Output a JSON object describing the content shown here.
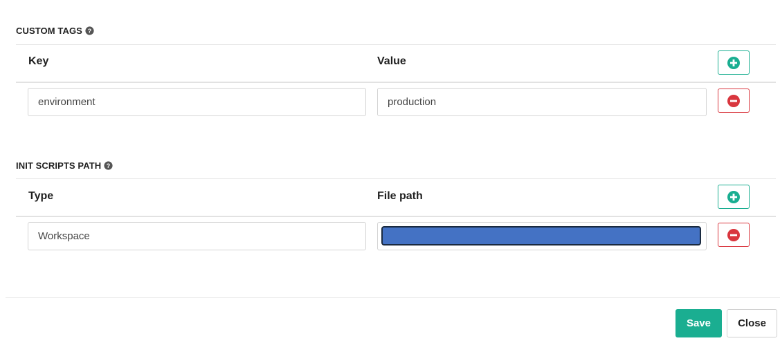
{
  "custom_tags": {
    "title": "CUSTOM TAGS",
    "help_icon": "question-circle-icon",
    "col_key": "Key",
    "col_value": "Value",
    "add_icon": "plus-circle-icon",
    "rows": [
      {
        "key": "environment",
        "value": "production",
        "remove_icon": "minus-circle-icon"
      }
    ]
  },
  "init_scripts": {
    "title": "INIT SCRIPTS PATH",
    "help_icon": "question-circle-icon",
    "col_type": "Type",
    "col_path": "File path",
    "add_icon": "plus-circle-icon",
    "rows": [
      {
        "type": "Workspace",
        "path_redacted": true,
        "remove_icon": "minus-circle-icon"
      }
    ]
  },
  "footer": {
    "save_label": "Save",
    "close_label": "Close"
  },
  "colors": {
    "accent": "#1aae91",
    "danger": "#d9363e",
    "redaction_fill": "#4472c4"
  }
}
